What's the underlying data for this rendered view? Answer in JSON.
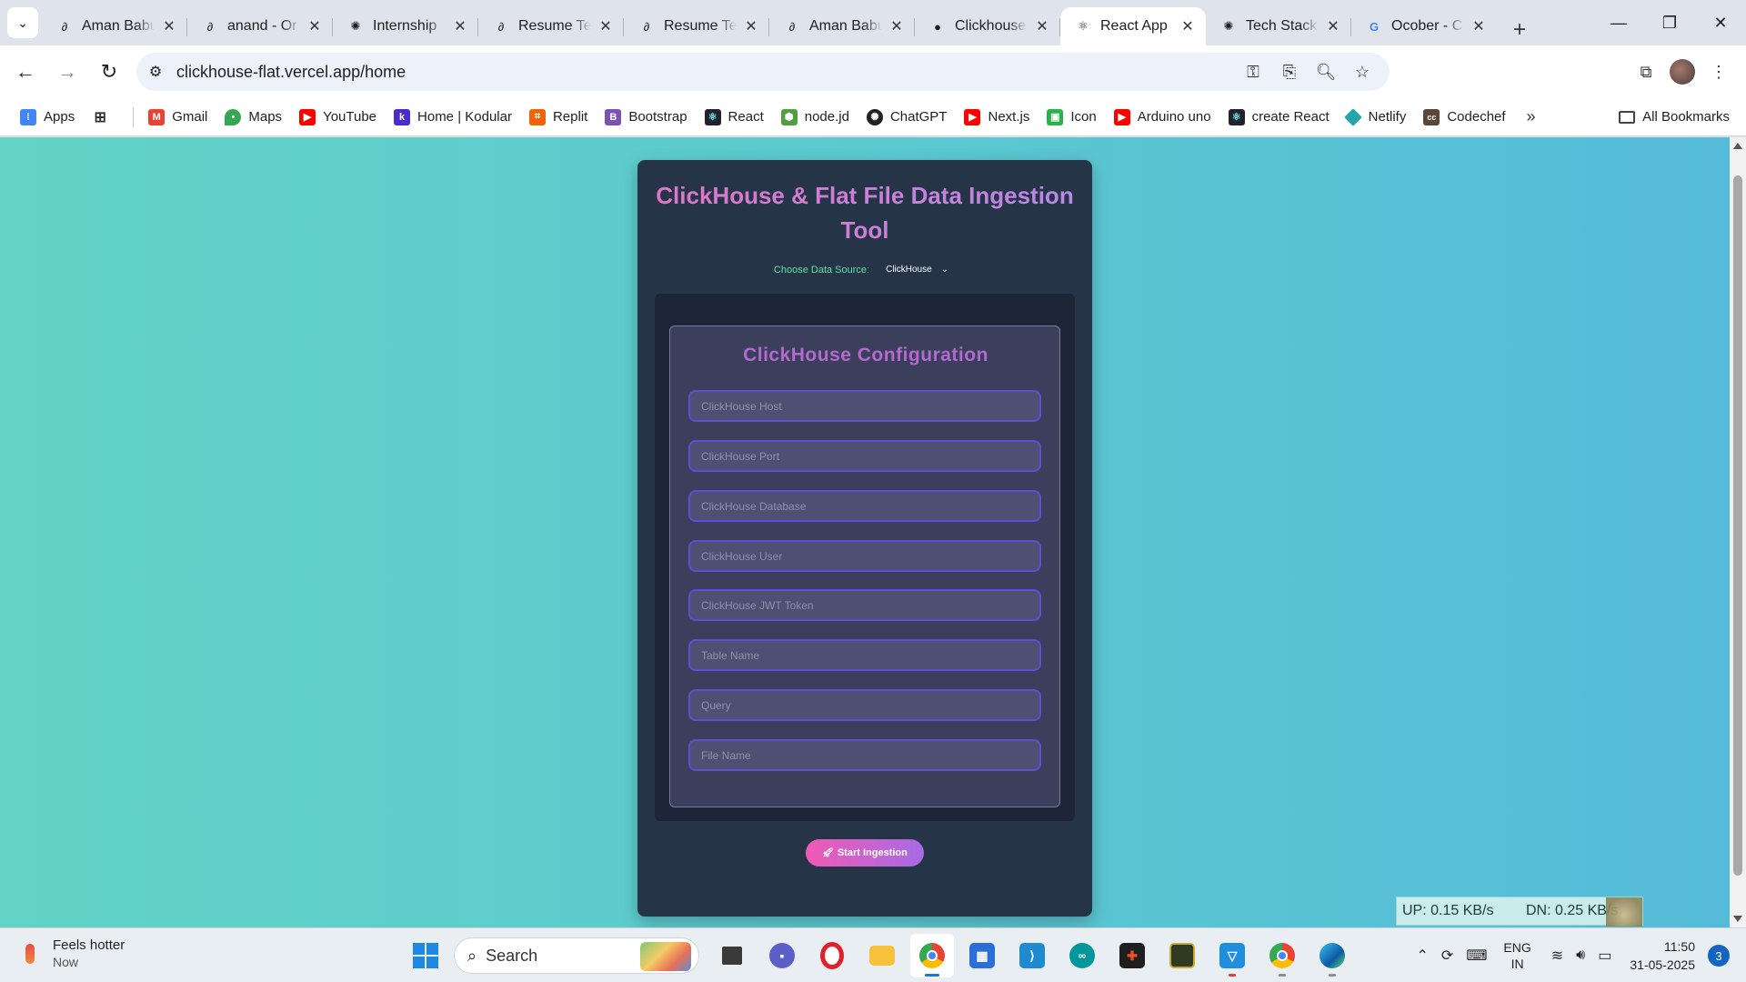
{
  "browser": {
    "tabs": [
      {
        "title": "Aman Babu",
        "icon": "link-icon",
        "active": false
      },
      {
        "title": "anand - Or",
        "icon": "link-icon",
        "active": false
      },
      {
        "title": "Internship",
        "icon": "chatgpt-icon",
        "active": false
      },
      {
        "title": "Resume Te",
        "icon": "link-icon",
        "active": false
      },
      {
        "title": "Resume Te",
        "icon": "link-icon",
        "active": false
      },
      {
        "title": "Aman Babu",
        "icon": "link-icon",
        "active": false
      },
      {
        "title": "Clickhouse",
        "icon": "github-icon",
        "active": false
      },
      {
        "title": "React App",
        "icon": "react-icon",
        "active": true
      },
      {
        "title": "Tech Stack",
        "icon": "chatgpt-icon",
        "active": false
      },
      {
        "title": "Ocober - C",
        "icon": "google-icon",
        "active": false
      }
    ],
    "url": "clickhouse-flat.vercel.app/home",
    "bookmarks": [
      {
        "label": "Apps",
        "icon": "apps-grid-icon",
        "color": "#4285f4"
      },
      {
        "label": "Gmail",
        "icon": "gmail-icon",
        "color": "#ea4335"
      },
      {
        "label": "Maps",
        "icon": "maps-icon",
        "color": "#34a853"
      },
      {
        "label": "YouTube",
        "icon": "youtube-icon",
        "color": "#ff0000"
      },
      {
        "label": "Home | Kodular",
        "icon": "kodular-icon",
        "color": "#4a2bd0"
      },
      {
        "label": "Replit",
        "icon": "replit-icon",
        "color": "#f26207"
      },
      {
        "label": "Bootstrap",
        "icon": "bootstrap-icon",
        "color": "#7952b3"
      },
      {
        "label": "React",
        "icon": "react-icon",
        "color": "#20232a"
      },
      {
        "label": "node.jd",
        "icon": "nodejs-icon",
        "color": "#539e43"
      },
      {
        "label": "ChatGPT",
        "icon": "chatgpt-icon",
        "color": "#202123"
      },
      {
        "label": "Next.js",
        "icon": "youtube-icon",
        "color": "#ff0000"
      },
      {
        "label": "Icon",
        "icon": "icon-site-icon",
        "color": "#2bb24c"
      },
      {
        "label": "Arduino uno",
        "icon": "youtube-icon",
        "color": "#ff0000"
      },
      {
        "label": "create React",
        "icon": "react-icon",
        "color": "#20232a"
      },
      {
        "label": "Netlify",
        "icon": "netlify-icon",
        "color": "#25a7a8"
      },
      {
        "label": "Codechef",
        "icon": "codechef-icon",
        "color": "#5b4638"
      }
    ],
    "all_bookmarks": "All Bookmarks"
  },
  "app": {
    "title": "ClickHouse & Flat File Data Ingestion Tool",
    "source_label": "Choose Data Source:",
    "source_value": "ClickHouse",
    "config_title": "ClickHouse Configuration",
    "fields": [
      {
        "placeholder": "ClickHouse Host",
        "value": ""
      },
      {
        "placeholder": "ClickHouse Port",
        "value": ""
      },
      {
        "placeholder": "ClickHouse Database",
        "value": ""
      },
      {
        "placeholder": "ClickHouse User",
        "value": ""
      },
      {
        "placeholder": "ClickHouse JWT Token",
        "value": ""
      },
      {
        "placeholder": "Table Name",
        "value": ""
      },
      {
        "placeholder": "Query",
        "value": ""
      },
      {
        "placeholder": "File Name",
        "value": ""
      }
    ],
    "start_button": "Start Ingestion",
    "start_icon": "rocket-icon"
  },
  "overlay": {
    "net_up": "UP: 0.15 KB/s",
    "net_down": "DN: 0.25 KB/s"
  },
  "taskbar": {
    "weather_title": "Feels hotter",
    "weather_sub": "Now",
    "search_label": "Search",
    "lang_top": "ENG",
    "lang_bottom": "IN",
    "time": "11:50",
    "date": "31-05-2025",
    "notifications": "3"
  },
  "colors": {
    "page_gradient_start": "#62d3c6",
    "page_gradient_end": "#55bbd9",
    "card_bg": "#263447",
    "title_gradient_start": "#e174c8",
    "title_gradient_end": "#b58be8",
    "source_label": "#5ee0a8",
    "field_border": "#5a4fd6",
    "button_gradient_start": "#f05ab4",
    "button_gradient_end": "#a76be6"
  }
}
